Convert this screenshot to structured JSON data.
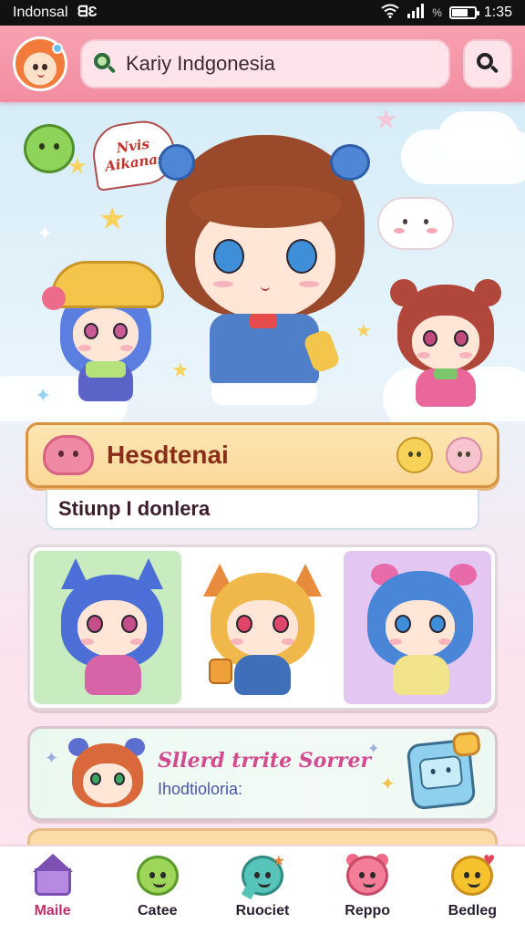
{
  "status_bar": {
    "carrier": "Indonsal",
    "carrier_badge": "ᗺƐ",
    "battery_level": 0.7,
    "time": "1:35"
  },
  "header": {
    "avatar_icon": "user-avatar",
    "search_placeholder": "Kariy Indgonesia",
    "search_icon": "search-icon"
  },
  "hero": {
    "speech_bubble": "Nvis\nAikanas",
    "accent": "#f7d25c"
  },
  "featured": {
    "title": "Hesdtenai",
    "subtitle": "Stiunp I donlera",
    "accent": "#d9933f"
  },
  "gallery": {
    "tiles": [
      {
        "name": "blue-cat-girl",
        "bg": "#c8ecc0"
      },
      {
        "name": "blonde-fox-boy",
        "bg": "#ffffff"
      },
      {
        "name": "blue-bow-girl",
        "bg": "#e3c6f1"
      }
    ]
  },
  "promo": {
    "title": "Sllerd trrite Sorrer",
    "subtitle": "Ihodtioloria:"
  },
  "nav": {
    "items": [
      {
        "label": "Maile",
        "icon": "home-icon",
        "active": true
      },
      {
        "label": "Catee",
        "icon": "smile-face-icon",
        "active": false
      },
      {
        "label": "Ruociet",
        "icon": "chat-bubble-icon",
        "active": false
      },
      {
        "label": "Reppo",
        "icon": "bear-face-icon",
        "active": false
      },
      {
        "label": "Bedleg",
        "icon": "chick-face-icon",
        "active": false
      }
    ]
  }
}
